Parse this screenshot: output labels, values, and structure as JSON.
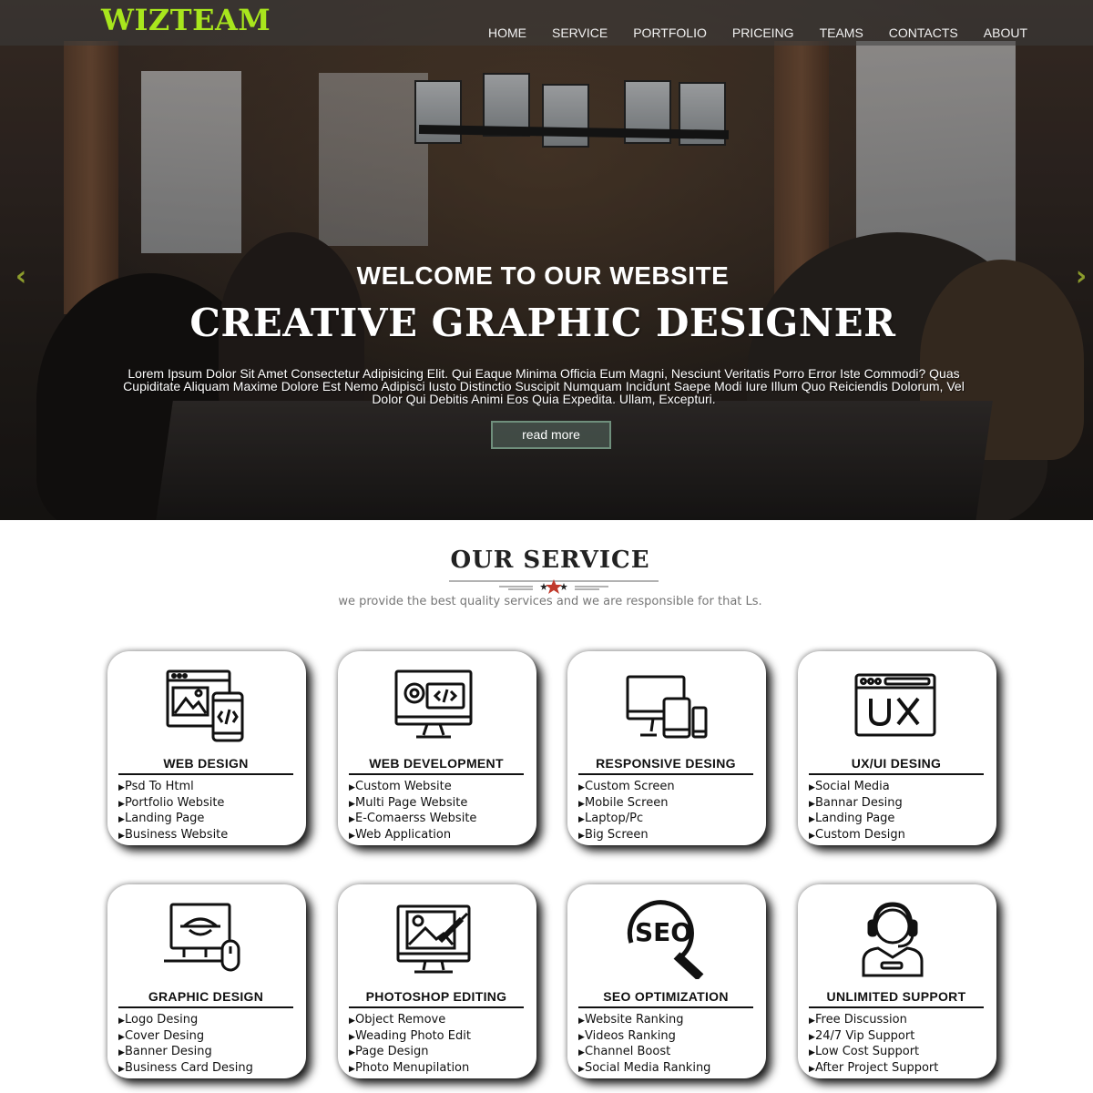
{
  "header": {
    "logo": "WIZTEAM",
    "nav": [
      "HOME",
      "SERVICE",
      "PORTFOLIO",
      "PRICEING",
      "TEAMS",
      "CONTACTS",
      "ABOUT"
    ]
  },
  "hero": {
    "welcome": "WELCOME TO OUR WEBSITE",
    "headline": "CREATIVE GRAPHIC DESIGNER",
    "paragraph": "Lorem Ipsum Dolor Sit Amet Consectetur Adipisicing Elit. Qui Eaque Minima Officia Eum Magni, Nesciunt Veritatis Porro Error Iste Commodi? Quas Cupiditate Aliquam Maxime Dolore Est Nemo Adipisci Iusto Distinctio Suscipit Numquam Incidunt Saepe Modi Iure Illum Quo Reiciendis Dolorum, Vel Dolor Qui Debitis Animi Eos Quia Expedita. Ullam, Excepturi.",
    "button": "read more",
    "prev_icon": "chevron-left-icon",
    "next_icon": "chevron-right-icon"
  },
  "service": {
    "title": "OUR SERVICE",
    "subtitle": "we provide the best quality services and we are responsible for that Ls.",
    "cards": [
      {
        "title": "WEB DESIGN",
        "icon": "web-design-icon",
        "items": [
          "Psd To Html",
          "Portfolio Website",
          "Landing Page",
          "Business Website"
        ]
      },
      {
        "title": "WEB DEVELOPMENT",
        "icon": "web-development-icon",
        "items": [
          "Custom Website",
          "Multi Page Website",
          "E-Comaerss Website",
          "Web Application"
        ]
      },
      {
        "title": "RESPONSIVE DESING",
        "icon": "responsive-devices-icon",
        "items": [
          "Custom Screen",
          "Mobile Screen",
          "Laptop/Pc",
          "Big Screen"
        ]
      },
      {
        "title": "UX/UI DESING",
        "icon": "ux-icon",
        "items": [
          "Social Media",
          "Bannar Desing",
          "Landing Page",
          "Custom Design"
        ]
      },
      {
        "title": "GRAPHIC DESIGN",
        "icon": "graphic-design-icon",
        "items": [
          "Logo Desing",
          "Cover Desing",
          "Banner Desing",
          "Business Card Desing"
        ]
      },
      {
        "title": "PHOTOSHOP EDITING",
        "icon": "photo-editing-icon",
        "items": [
          "Object Remove",
          "Weading Photo Edit",
          "Page Design",
          "Photo Menupilation"
        ]
      },
      {
        "title": "SEO OPTIMIZATION",
        "icon": "seo-icon",
        "items": [
          "Website Ranking",
          "Videos Ranking",
          "Channel Boost",
          "Social Media Ranking"
        ]
      },
      {
        "title": "UNLIMITED SUPPORT",
        "icon": "support-agent-icon",
        "items": [
          "Free Discussion",
          "24/7 Vip Support",
          "Low Cost Support",
          "After Project Support"
        ]
      }
    ]
  },
  "colors": {
    "logo": "#a8e61d",
    "divider_star": "#c0392b",
    "arrow": "#8c9c2c"
  }
}
